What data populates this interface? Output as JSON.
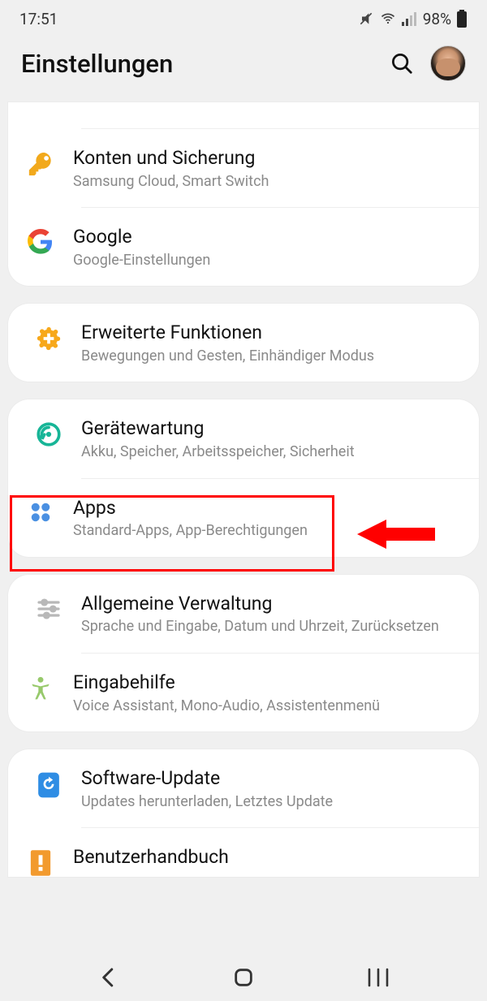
{
  "status": {
    "time": "17:51",
    "battery": "98%"
  },
  "header": {
    "title": "Einstellungen"
  },
  "groups": [
    {
      "partial_top": true,
      "items": [
        {
          "key": "konten",
          "title": "Konten und Sicherung",
          "sub": "Samsung Cloud, Smart Switch",
          "icon": "key",
          "color": "#f2a91c"
        },
        {
          "key": "google",
          "title": "Google",
          "sub": "Google-Einstellungen",
          "icon": "google",
          "color": "#4285F4"
        }
      ]
    },
    {
      "items": [
        {
          "key": "erweitert",
          "title": "Erweiterte Funktionen",
          "sub": "Bewegungen und Gesten, Einhändiger Modus",
          "icon": "gear-plus",
          "color": "#f7a81b"
        }
      ]
    },
    {
      "items": [
        {
          "key": "wartung",
          "title": "Gerätewartung",
          "sub": "Akku, Speicher, Arbeitsspeicher, Sicherheit",
          "icon": "care",
          "color": "#17b597"
        },
        {
          "key": "apps",
          "title": "Apps",
          "sub": "Standard-Apps, App-Berechtigungen",
          "icon": "apps",
          "color": "#4a90e2"
        }
      ]
    },
    {
      "items": [
        {
          "key": "allgemein",
          "title": "Allgemeine Verwaltung",
          "sub": "Sprache und Eingabe, Datum und Uhrzeit, Zurücksetzen",
          "icon": "sliders",
          "color": "#b8b8b8"
        },
        {
          "key": "eingabe",
          "title": "Eingabehilfe",
          "sub": "Voice Assistant, Mono-Audio, Assistentenmenü",
          "icon": "person",
          "color": "#97c96b"
        }
      ]
    },
    {
      "cut_bottom": true,
      "items": [
        {
          "key": "update",
          "title": "Software-Update",
          "sub": "Updates herunterladen, Letztes Update",
          "icon": "refresh",
          "color": "#2f8de4"
        },
        {
          "key": "handbuch",
          "title": "Benutzerhandbuch",
          "sub": "",
          "icon": "book",
          "color": "#f29a2e"
        }
      ]
    }
  ],
  "annotation": {
    "highlighted_item": "apps"
  }
}
